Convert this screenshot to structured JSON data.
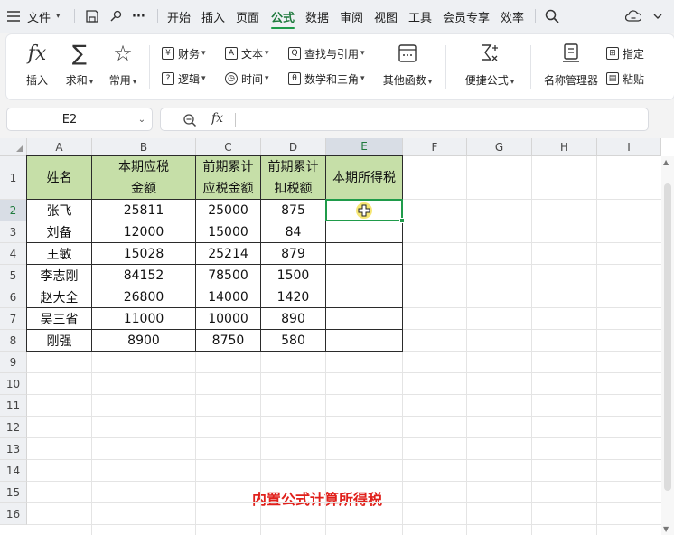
{
  "menubar": {
    "file_label": "文件",
    "tabs": [
      "开始",
      "插入",
      "页面",
      "公式",
      "数据",
      "审阅",
      "视图",
      "工具",
      "会员专享",
      "效率"
    ],
    "active_tab": "公式",
    "more_label": "···"
  },
  "ribbon": {
    "insert_fn_label": "插入",
    "sum_label": "求和",
    "common_label": "常用",
    "finance_label": "财务",
    "logic_label": "逻辑",
    "text_label": "文本",
    "time_label": "时间",
    "lookup_label": "查找与引用",
    "math_label": "数学和三角",
    "other_fn_label": "其他函数",
    "quick_formula_label": "便捷公式",
    "name_manager_label": "名称管理器",
    "specify_label": "指定",
    "paste_label": "粘贴"
  },
  "formula_bar": {
    "name_box": "E2",
    "fx_label": "fx",
    "content": ""
  },
  "sheet": {
    "columns": [
      "A",
      "B",
      "C",
      "D",
      "E",
      "F",
      "G",
      "H",
      "I"
    ],
    "rows": [
      "1",
      "2",
      "3",
      "4",
      "5",
      "6",
      "7",
      "8",
      "9",
      "10",
      "11",
      "12",
      "13",
      "14",
      "15",
      "16"
    ],
    "selected_cell": "E2",
    "headers": [
      "姓名",
      "本期应税金额",
      "前期累计应税金额",
      "前期累计扣税额",
      "本期所得税"
    ],
    "header_lines": [
      [
        "姓名"
      ],
      [
        "本期应税",
        "金额"
      ],
      [
        "前期累计",
        "应税金额"
      ],
      [
        "前期累计",
        "扣税额"
      ],
      [
        "本期所得税"
      ]
    ],
    "data": [
      [
        "张飞",
        "25811",
        "25000",
        "875",
        ""
      ],
      [
        "刘备",
        "12000",
        "15000",
        "84",
        ""
      ],
      [
        "王敏",
        "15028",
        "25214",
        "879",
        ""
      ],
      [
        "李志刚",
        "84152",
        "78500",
        "1500",
        ""
      ],
      [
        "赵大全",
        "26800",
        "14000",
        "1420",
        ""
      ],
      [
        "吴三省",
        "11000",
        "10000",
        "890",
        ""
      ],
      [
        "刚强",
        "8900",
        "8750",
        "580",
        ""
      ]
    ],
    "header_fill": "#c6dfa8",
    "selection_color": "#1f9b4a"
  },
  "caption": "内置公式计算所得税",
  "caption_color": "#e0201b"
}
